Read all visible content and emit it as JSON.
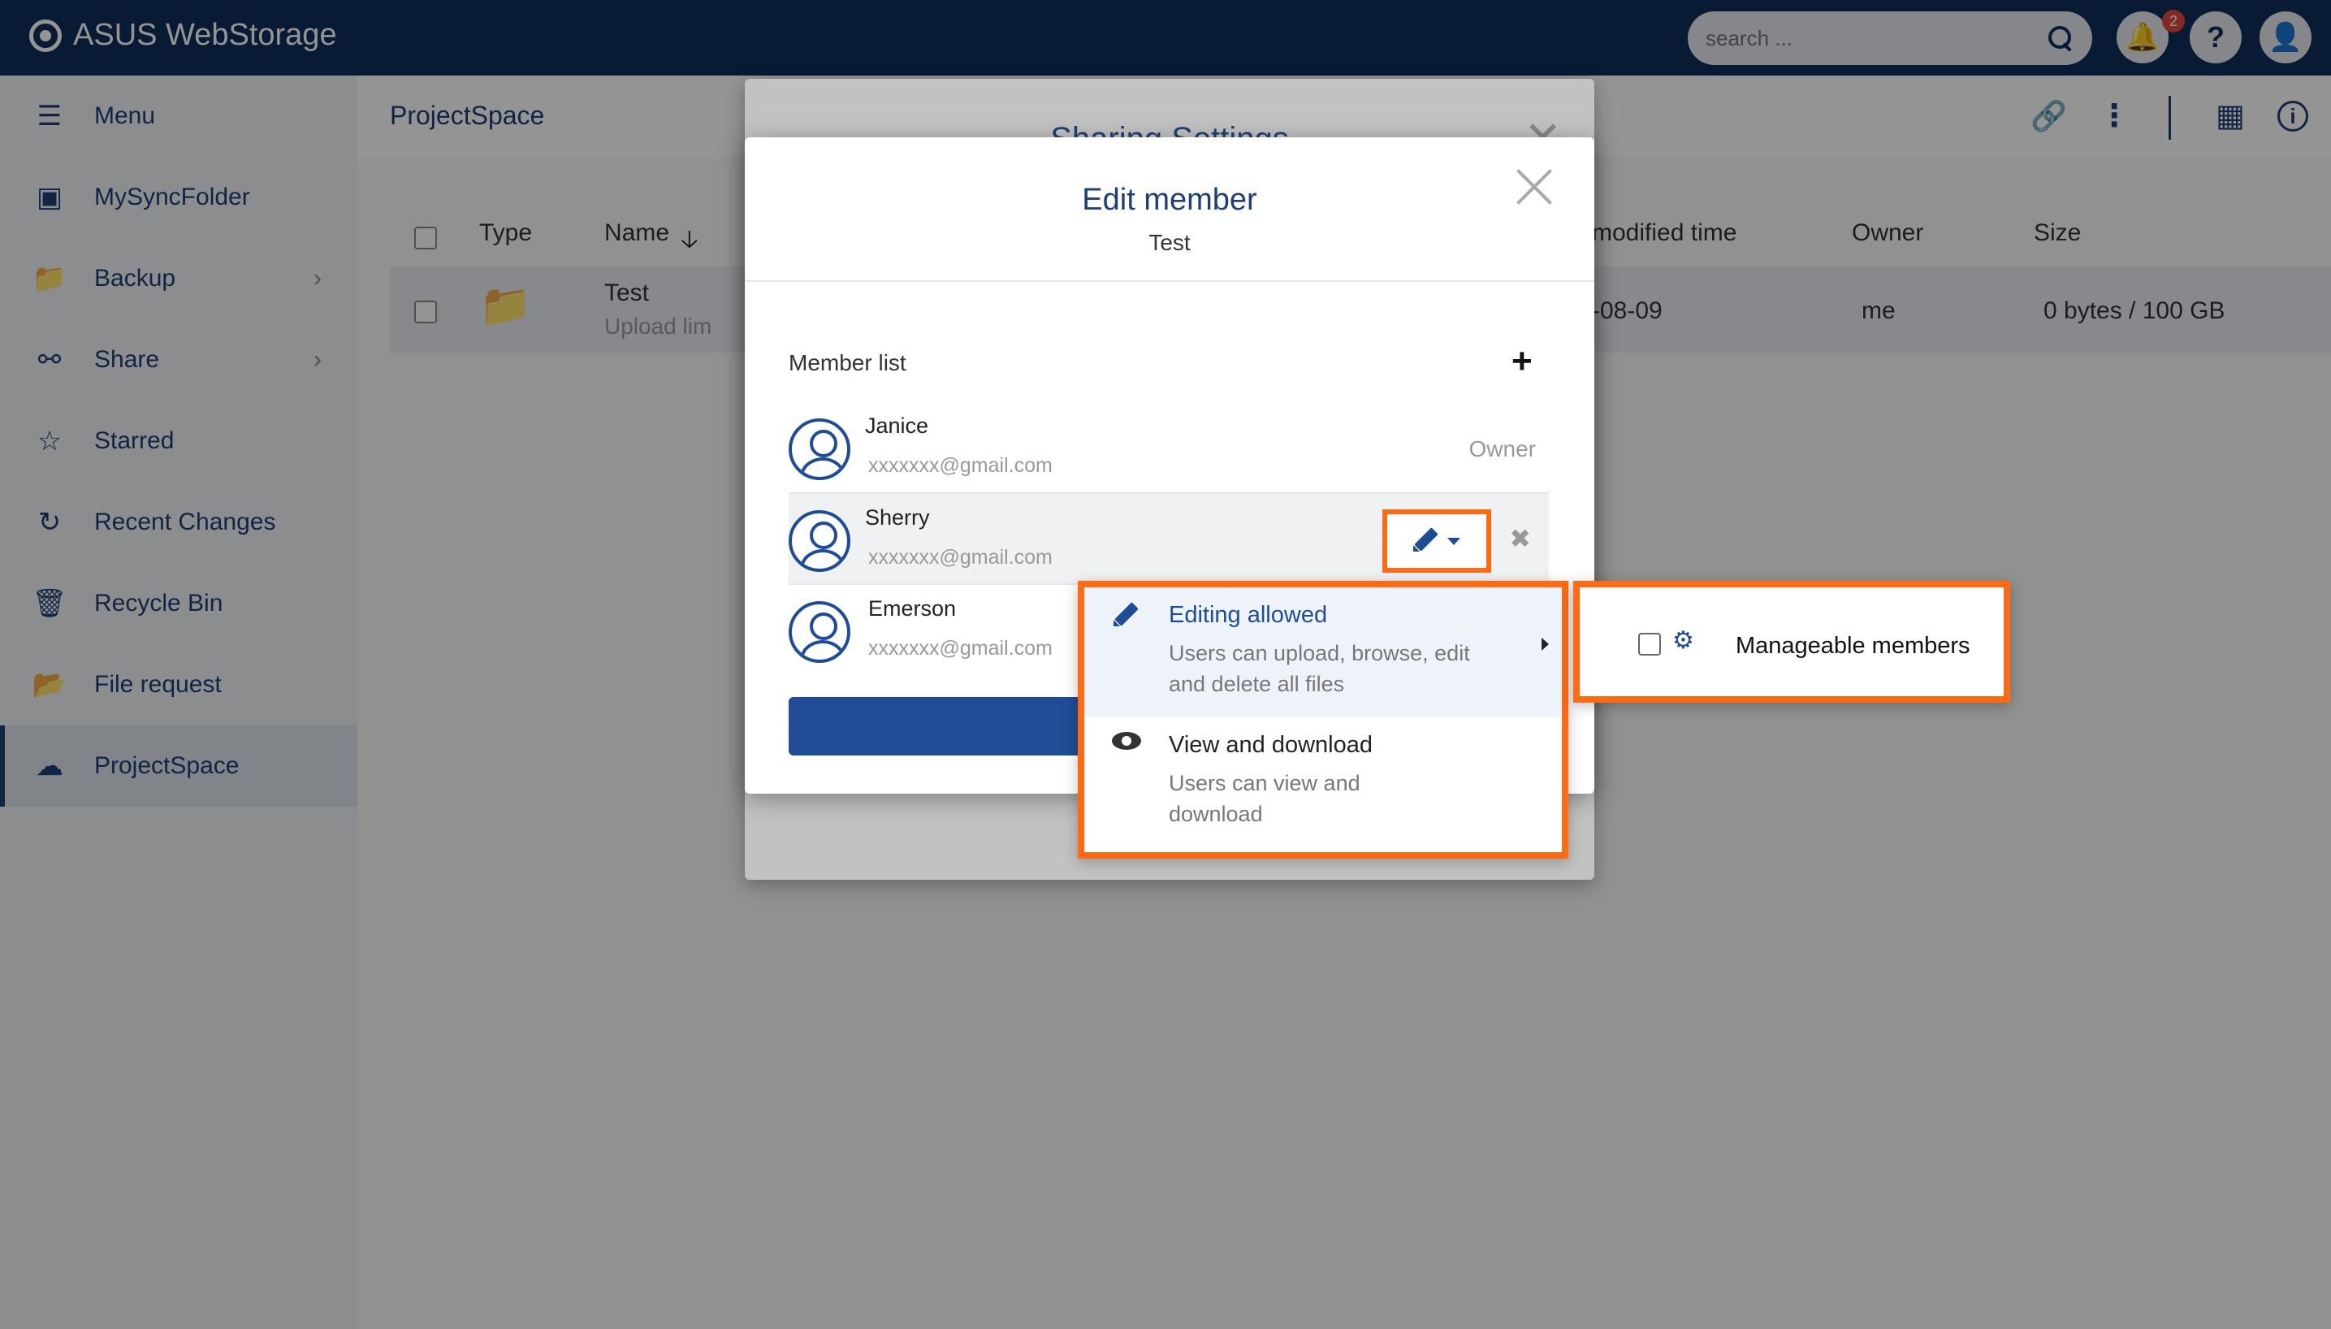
{
  "app": {
    "title": "ASUS WebStorage"
  },
  "search": {
    "placeholder": "search ..."
  },
  "header": {
    "notification_count": "2"
  },
  "sidebar": {
    "menu_label": "Menu",
    "items": [
      {
        "label": "MySyncFolder",
        "icon": "laptop-icon"
      },
      {
        "label": "Backup",
        "icon": "backup-folder-icon",
        "has_children": true
      },
      {
        "label": "Share",
        "icon": "people-icon",
        "has_children": true
      },
      {
        "label": "Starred",
        "icon": "star-icon"
      },
      {
        "label": "Recent Changes",
        "icon": "refresh-icon"
      },
      {
        "label": "Recycle Bin",
        "icon": "trash-icon"
      },
      {
        "label": "File request",
        "icon": "file-request-icon"
      },
      {
        "label": "ProjectSpace",
        "icon": "projectspace-icon",
        "active": true
      }
    ]
  },
  "breadcrumb": "ProjectSpace",
  "table": {
    "columns": {
      "type": "Type",
      "name": "Name",
      "modified": "modified time",
      "owner": "Owner",
      "size": "Size"
    },
    "rows": [
      {
        "name": "Test",
        "sub": "Upload lim",
        "modified": "-08-09",
        "owner": "me",
        "size": "0 bytes / 100 GB"
      }
    ]
  },
  "back_dialog": {
    "title": "Sharing Settings"
  },
  "dialog": {
    "title": "Edit member",
    "subtitle": "Test",
    "member_list_label": "Member list",
    "members": [
      {
        "name": "Janice",
        "email": "xxxxxxx@gmail.com",
        "role": "Owner"
      },
      {
        "name": "Sherry",
        "email": "xxxxxxx@gmail.com",
        "role": ""
      },
      {
        "name": "Emerson",
        "email": "xxxxxxx@gmail.com",
        "role": ""
      }
    ]
  },
  "permission_menu": {
    "items": [
      {
        "title": "Editing allowed",
        "description": "Users can upload, browse, edit and delete all files",
        "icon": "pencil-icon",
        "highlighted": true,
        "has_submenu": true
      },
      {
        "title": "View and download",
        "description": "Users can view and download",
        "icon": "eye-icon",
        "highlighted": false
      }
    ]
  },
  "submenu": {
    "checkbox_label": "Manageable members",
    "checked": false
  },
  "colors": {
    "brand_navy": "#0e2d5b",
    "accent_blue": "#1f4c95",
    "highlight_orange": "#ff6a13"
  }
}
